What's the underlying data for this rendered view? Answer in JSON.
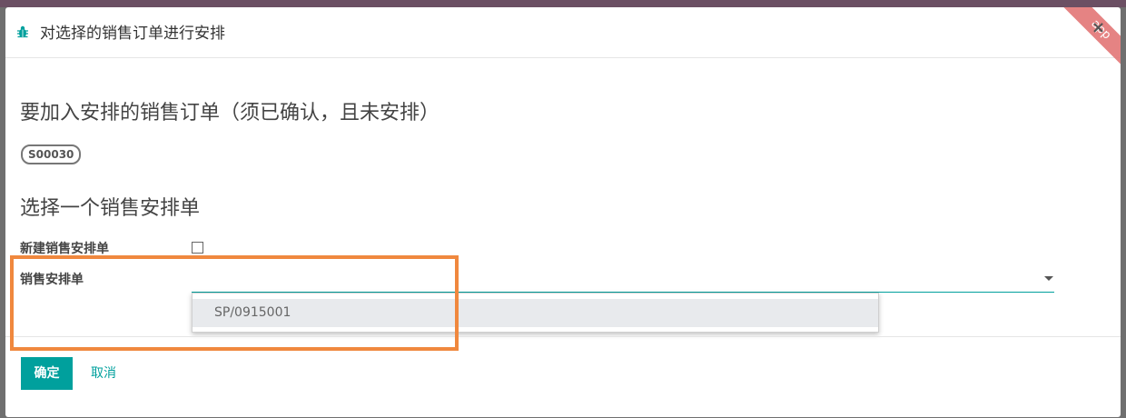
{
  "modal": {
    "title": "对选择的销售订单进行安排",
    "ribbon": "app",
    "close": "×"
  },
  "section1": {
    "title": "要加入安排的销售订单（须已确认，且未安排）",
    "order_tag": "S00030"
  },
  "section2": {
    "title": "选择一个销售安排单",
    "new_label": "新建销售安排单",
    "new_checked": false,
    "select_label": "销售安排单",
    "select_value": "",
    "dropdown_options": [
      "SP/0915001"
    ]
  },
  "footer": {
    "confirm_label": "确定",
    "cancel_label": "取消"
  },
  "colors": {
    "primary": "#00a09d",
    "highlight": "#f0883e"
  }
}
